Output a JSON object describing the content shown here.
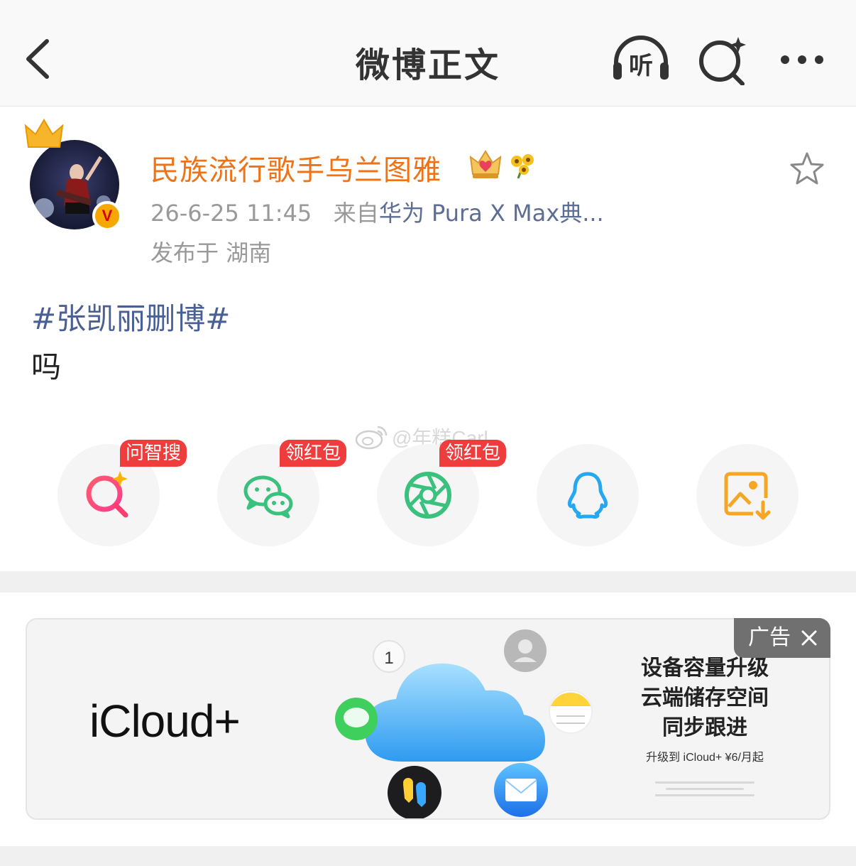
{
  "header": {
    "title": "微博正文",
    "listen_label": "听"
  },
  "post": {
    "username": "民族流行歌手乌兰图雅",
    "verified_mark": "V",
    "timestamp": "26-6-25 11:45",
    "source_prefix": "来自",
    "source": "华为 Pura X Max典...",
    "location_prefix": "发布于",
    "location": "湖南",
    "hashtag": "#张凯丽删博#",
    "text": "吗"
  },
  "watermark": "@年糕Carl",
  "share": [
    {
      "name": "ask-search",
      "tag": "问智搜",
      "icon": "search-spark-icon"
    },
    {
      "name": "wechat",
      "tag": "领红包",
      "icon": "wechat-icon"
    },
    {
      "name": "moments",
      "tag": "领红包",
      "icon": "aperture-icon"
    },
    {
      "name": "qq",
      "tag": "",
      "icon": "qq-penguin-icon"
    },
    {
      "name": "save-image",
      "tag": "",
      "icon": "image-download-icon"
    }
  ],
  "ad": {
    "label": "广告",
    "brand": "iCloud+",
    "lines": [
      "设备容量升级",
      "云端储存空间",
      "同步跟进"
    ],
    "small": "升级到 iCloud+ ¥6/月起",
    "calendar_day": "1"
  },
  "colors": {
    "username": "#ef7316",
    "hashtag": "#4a5f93",
    "tag_red": "#ef3c3c"
  }
}
